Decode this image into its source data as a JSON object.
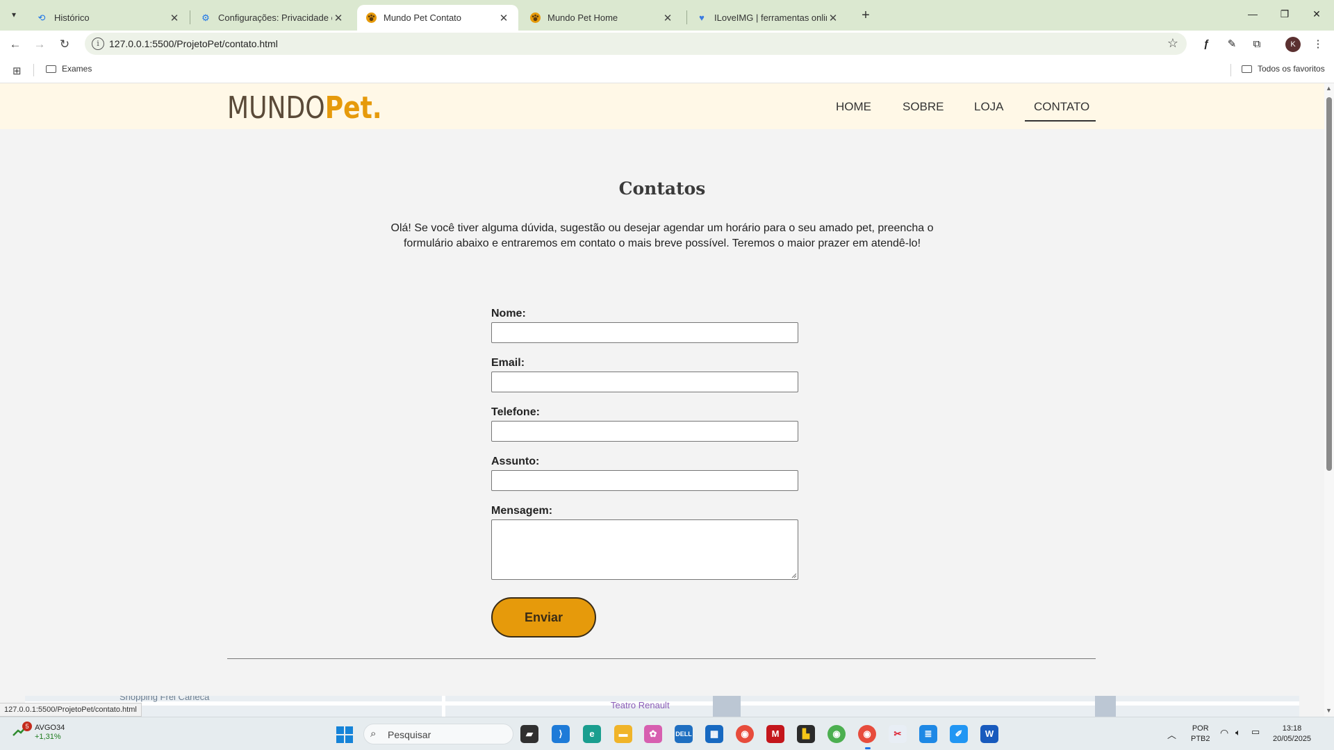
{
  "browser": {
    "tabs": [
      {
        "title": "Histórico",
        "icon": "history-icon"
      },
      {
        "title": "Configurações: Privacidade e se",
        "icon": "gear-icon"
      },
      {
        "title": "Mundo Pet Contato",
        "icon": "paw-icon",
        "active": true
      },
      {
        "title": "Mundo Pet Home",
        "icon": "paw-icon"
      },
      {
        "title": "ILoveIMG | ferramentas online p",
        "icon": "heart-icon"
      }
    ],
    "url": "127.0.0.1:5500/ProjetoPet/contato.html",
    "profile_initial": "K",
    "bookmarks": {
      "folder": "Exames",
      "all": "Todos os favoritos"
    },
    "status_url": "127.0.0.1:5500/ProjetoPet/contato.html"
  },
  "site": {
    "logo": {
      "part1": "MUNDO",
      "part2": "Pet."
    },
    "nav": [
      "HOME",
      "SOBRE",
      "LOJA",
      "CONTATO"
    ],
    "active_nav": "CONTATO",
    "colors": {
      "accent": "#e69a0b",
      "header_bg": "#fff8e7",
      "logo_dark": "#5a4a38"
    }
  },
  "contact": {
    "title": "Contatos",
    "intro": "Olá! Se você tiver alguma dúvida, sugestão ou desejar agendar um horário para o seu amado pet, preencha o formulário abaixo e entraremos em contato o mais breve possível. Teremos o maior prazer em atendê-lo!",
    "fields": {
      "nome": "Nome:",
      "email": "Email:",
      "telefone": "Telefone:",
      "assunto": "Assunto:",
      "mensagem": "Mensagem:"
    },
    "values": {
      "nome": "",
      "email": "",
      "telefone": "",
      "assunto": "",
      "mensagem": ""
    },
    "submit": "Enviar"
  },
  "map": {
    "labels": [
      "Shopping Frei Caneca",
      "Teatro Renault"
    ]
  },
  "taskbar": {
    "stock": {
      "ticker": "AVGO34",
      "change": "+1,31%",
      "badge": "5"
    },
    "search_placeholder": "Pesquisar",
    "lang": "POR",
    "layout": "PTB2",
    "time": "13:18",
    "date": "20/05/2025"
  }
}
